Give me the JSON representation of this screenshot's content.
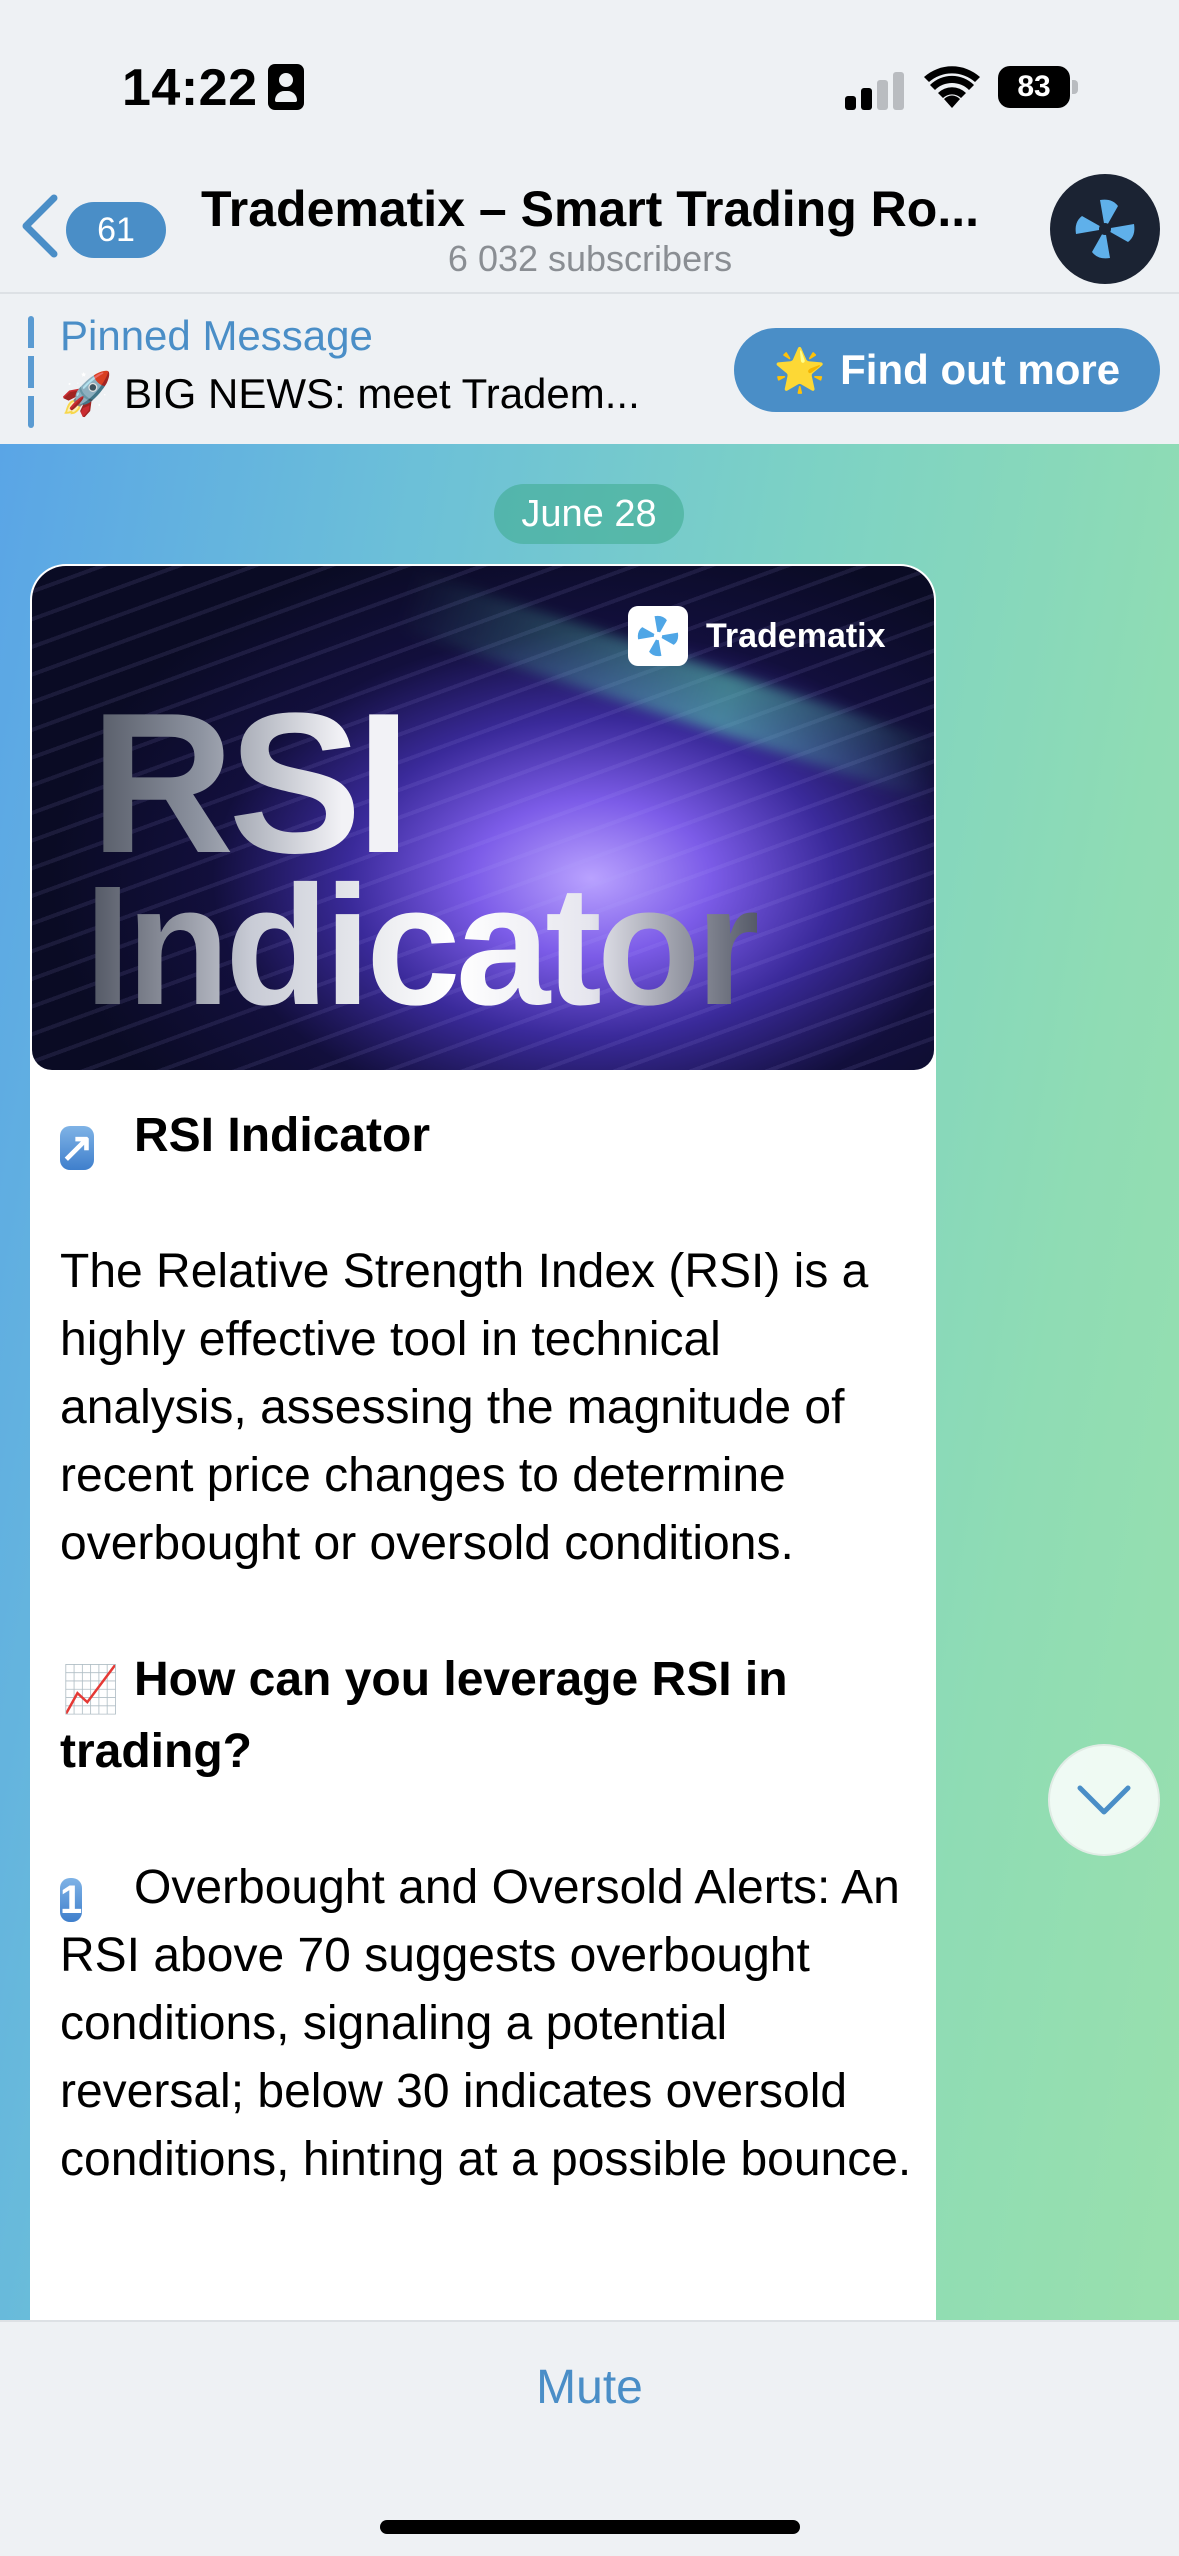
{
  "status_bar": {
    "time": "14:22",
    "battery_level": "83"
  },
  "header": {
    "back_count": "61",
    "title": "Tradematix – Smart Trading Ro...",
    "subtitle": "6 032 subscribers",
    "avatar_icon": "tradematix-logo-icon"
  },
  "pinned": {
    "title": "Pinned Message",
    "text": "🚀 BIG NEWS: meet Tradem...",
    "button_emoji": "🌟",
    "button_label": "Find out more"
  },
  "chat": {
    "date": "June 28",
    "post": {
      "image": {
        "brand": "Tradematix",
        "line1": "RSI",
        "line2": "Indicator"
      },
      "heading1_emoji": "↗",
      "heading1": "RSI Indicator",
      "para1": "The Relative Strength Index (RSI) is a highly effective tool in technical analysis, assessing the magnitude of recent price changes to determine overbought or oversold conditions.",
      "heading2_emoji": "📈",
      "heading2": "How can you leverage RSI in trading?",
      "item1_emoji": "1",
      "item1": "Overbought and Oversold Alerts: An RSI above 70 suggests overbought conditions, signaling a potential reversal; below 30 indicates oversold conditions, hinting at a possible bounce."
    }
  },
  "bottom": {
    "mute_label": "Mute"
  },
  "colors": {
    "accent": "#4a8ec7",
    "bar_background": "#eef1f4"
  }
}
